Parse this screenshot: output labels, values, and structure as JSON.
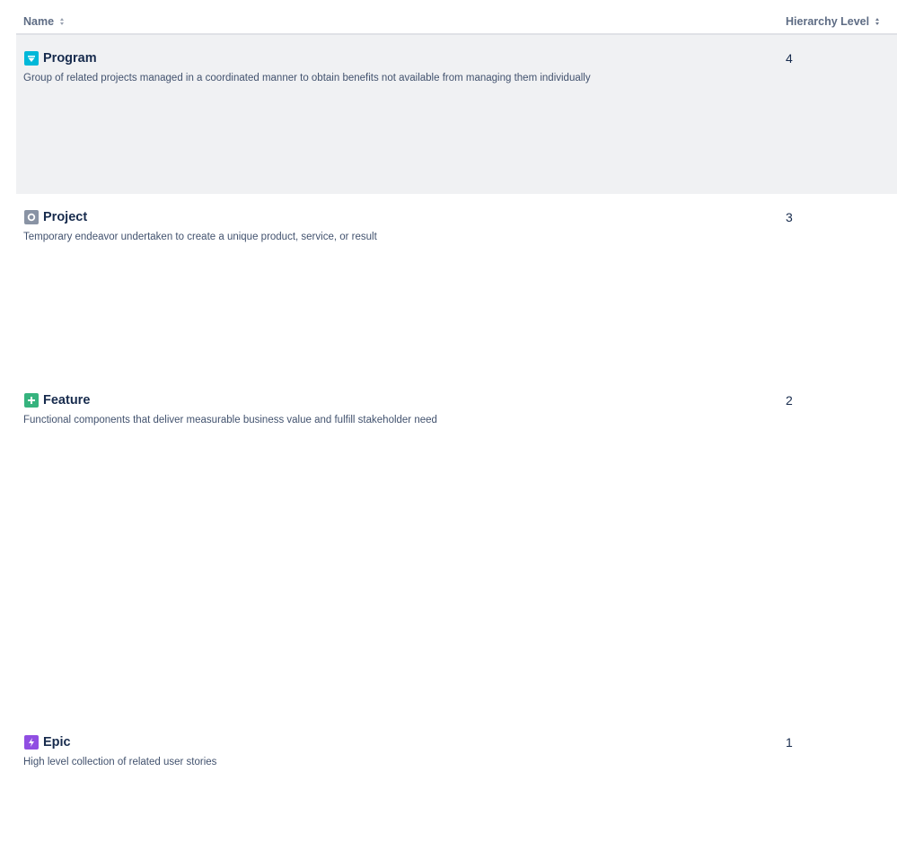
{
  "table": {
    "columns": {
      "name": "Name",
      "level": "Hierarchy Level"
    },
    "rows": [
      {
        "name": "Program",
        "description": "Group of related projects managed in a coordinated manner to obtain benefits not available from managing them individually",
        "level": "4",
        "icon": "program-diamond-icon",
        "icon_color": "#00b8d9",
        "selected": true
      },
      {
        "name": "Project",
        "description": "Temporary endeavor undertaken to create a unique product, service, or result",
        "level": "3",
        "icon": "project-circle-icon",
        "icon_color": "#8993a4",
        "selected": false
      },
      {
        "name": "Feature",
        "description": "Functional components that deliver measurable business value and fulfill stakeholder need",
        "level": "2",
        "icon": "feature-plus-icon",
        "icon_color": "#36b37e",
        "selected": false
      },
      {
        "name": "Epic",
        "description": "High level collection of related user stories",
        "level": "1",
        "icon": "epic-lightning-icon",
        "icon_color": "#904ee2",
        "selected": false
      }
    ]
  },
  "colors": {
    "selected_row_bg": "#f0f1f3",
    "header_text": "#5e6c84",
    "title_text": "#172b4d",
    "description_text": "#42526e",
    "header_border": "#dfe1e6"
  }
}
